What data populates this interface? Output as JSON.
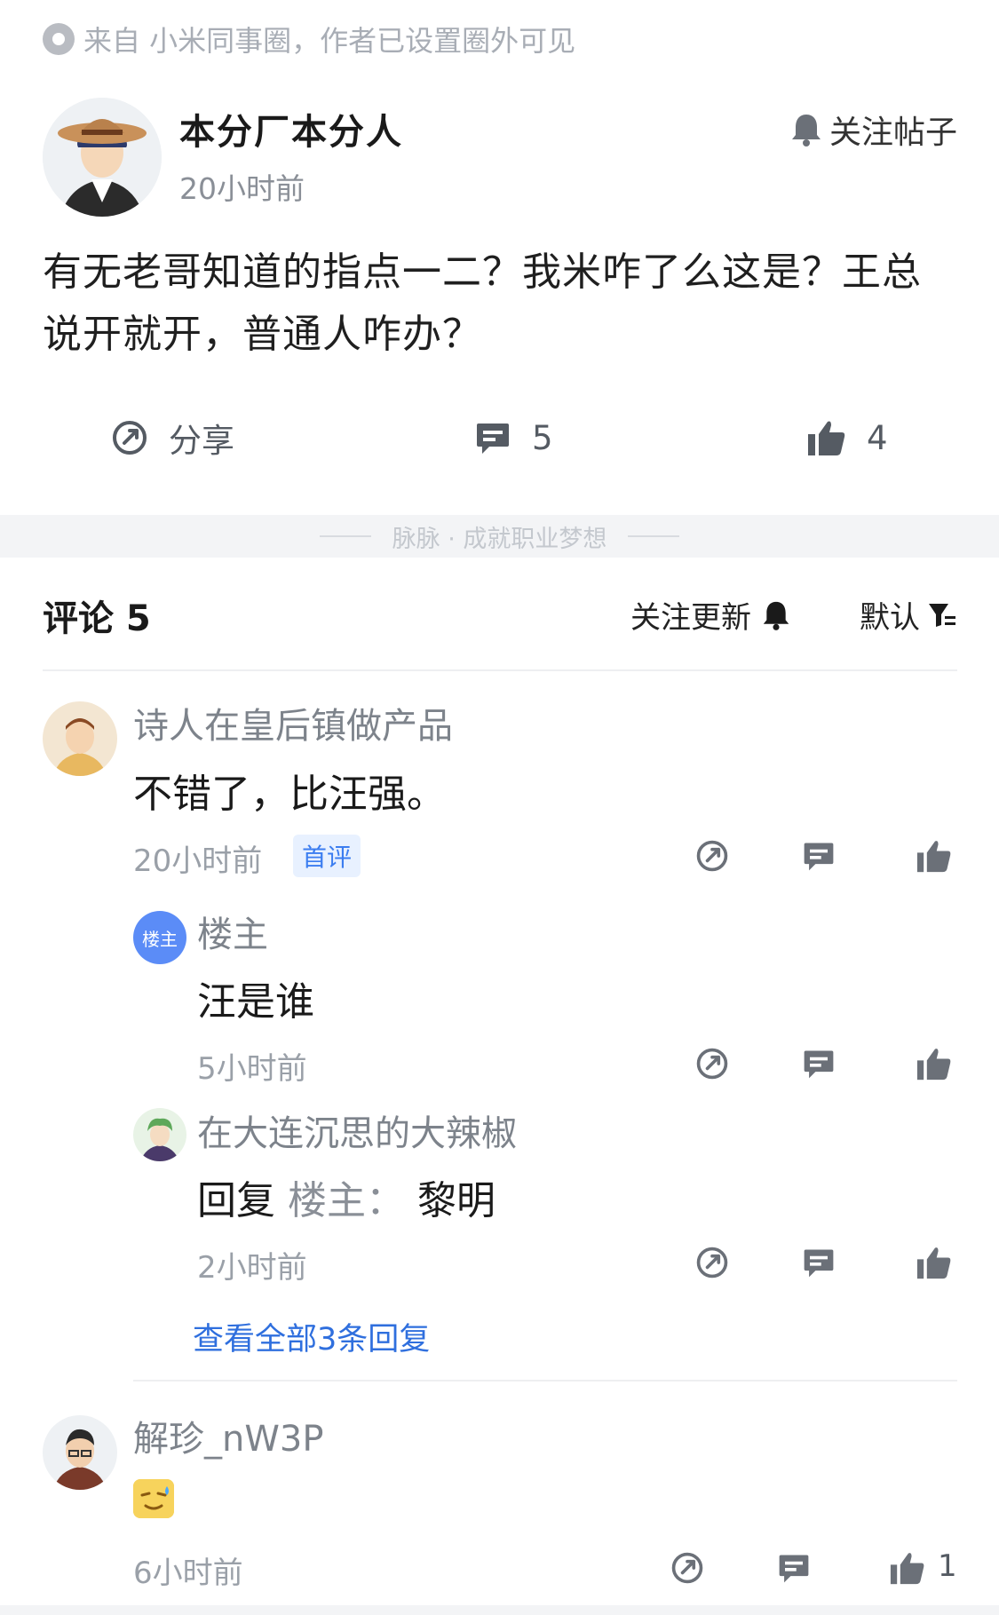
{
  "source": {
    "text": "来自 小米同事圈，作者已设置圈外可见",
    "icon": "circle-dot-icon"
  },
  "post": {
    "author": "本分厂本分人",
    "time": "20小时前",
    "follow_label": "关注帖子",
    "content": "有无老哥知道的指点一二？我米咋了么这是？王总说开就开，普通人咋办？",
    "actions": {
      "share_label": "分享",
      "comment_count": "5",
      "like_count": "4"
    }
  },
  "brand_tagline": "脉脉 · 成就职业梦想",
  "comments_header": {
    "title": "评论 5",
    "follow_updates": "关注更新",
    "sort": "默认"
  },
  "comments": [
    {
      "name": "诗人在皇后镇做产品",
      "text": "不错了，比汪强。",
      "time": "20小时前",
      "badge": "首评",
      "replies": [
        {
          "name": "楼主",
          "avatar_label": "楼主",
          "text": "汪是谁",
          "time": "5小时前"
        },
        {
          "name": "在大连沉思的大辣椒",
          "reply_prefix": "回复",
          "reply_target": "楼主：",
          "text": "黎明",
          "time": "2小时前"
        }
      ],
      "view_all": "查看全部3条回复"
    },
    {
      "name": "解珍_nW3P",
      "time": "6小时前",
      "like_count": "1",
      "emoji": "sweat-smile-emoji"
    }
  ],
  "colors": {
    "accent_blue": "#2f6fde",
    "badge_bg": "#e8f1ff",
    "owner_badge": "#5b8cf7",
    "muted_text": "#8a8f97"
  }
}
